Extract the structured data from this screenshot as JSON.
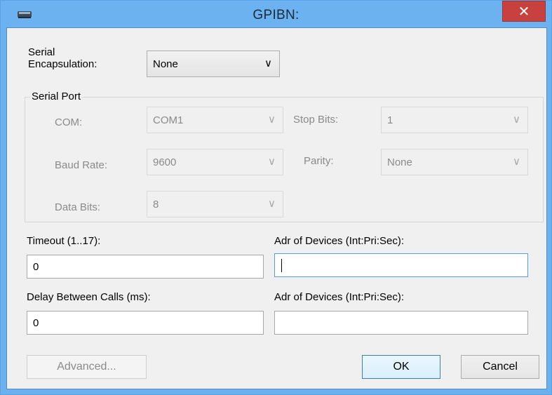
{
  "window": {
    "title": "GPIBN:",
    "close_glyph": "✕",
    "app_icon": "gpib-device-icon"
  },
  "serial_encapsulation": {
    "label_line1": "Serial",
    "label_line2": "Encapsulation:",
    "value": "None"
  },
  "serial_port": {
    "legend": "Serial Port",
    "com": {
      "label": "COM:",
      "value": "COM1"
    },
    "baud_rate": {
      "label": "Baud Rate:",
      "value": "9600"
    },
    "data_bits": {
      "label": "Data Bits:",
      "value": "8"
    },
    "stop_bits": {
      "label": "Stop Bits:",
      "value": "1"
    },
    "parity": {
      "label": "Parity:",
      "value": "None"
    }
  },
  "timeout": {
    "label": "Timeout (1..17):",
    "value": "0"
  },
  "delay": {
    "label": "Delay Between Calls (ms):",
    "value": "0"
  },
  "adr_devices_1": {
    "label": "Adr of Devices (Int:Pri:Sec):",
    "value": ""
  },
  "adr_devices_2": {
    "label": "Adr of Devices (Int:Pri:Sec):",
    "value": ""
  },
  "buttons": {
    "advanced": "Advanced...",
    "ok": "OK",
    "cancel": "Cancel"
  },
  "dropdown_arrow": "∨"
}
